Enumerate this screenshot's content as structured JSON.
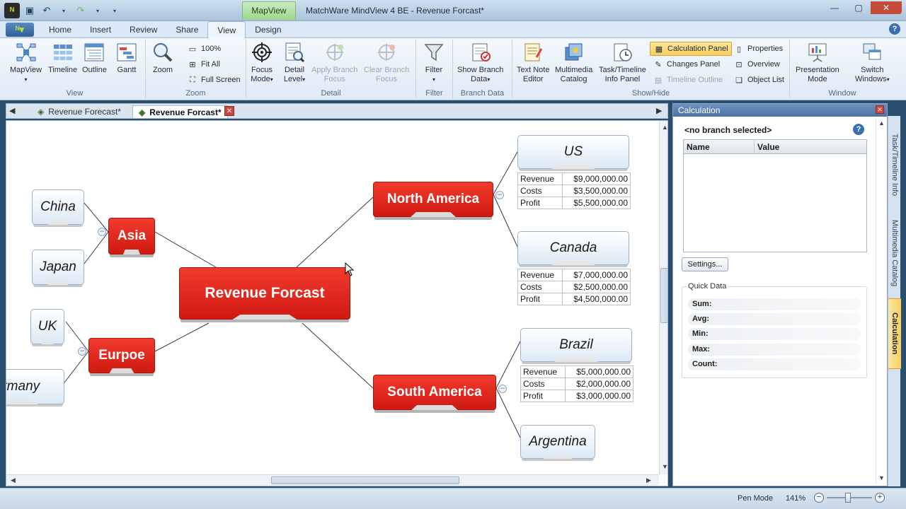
{
  "window": {
    "title": "MatchWare MindView 4 BE - Revenue Forcast*",
    "context_tab": "MapView",
    "controls": [
      "—",
      "▢",
      "✕"
    ]
  },
  "ribbon_tabs": [
    "Home",
    "Insert",
    "Review",
    "Share",
    "View",
    "Design"
  ],
  "active_tab": "View",
  "ribbon": {
    "view": {
      "label": "View",
      "mapview": "MapView",
      "timeline": "Timeline",
      "outline": "Outline",
      "gantt": "Gantt"
    },
    "zoom": {
      "label": "Zoom",
      "zoom": "Zoom",
      "pct100": "100%",
      "fit_all": "Fit All",
      "full_screen": "Full Screen"
    },
    "detail": {
      "label": "Detail",
      "focus_mode_1": "Focus",
      "focus_mode_2": "Mode",
      "detail_level_1": "Detail",
      "detail_level_2": "Level",
      "apply_focus_1": "Apply Branch",
      "apply_focus_2": "Focus",
      "clear_focus_1": "Clear Branch",
      "clear_focus_2": "Focus"
    },
    "filter": {
      "label": "Filter",
      "filter": "Filter"
    },
    "branch_data": {
      "label": "Branch Data",
      "show_1": "Show Branch",
      "show_2": "Data"
    },
    "show_hide": {
      "label": "Show/Hide",
      "text_note_1": "Text Note",
      "text_note_2": "Editor",
      "multimedia_1": "Multimedia",
      "multimedia_2": "Catalog",
      "task_info_1": "Task/Timeline",
      "task_info_2": "Info Panel",
      "calc_panel": "Calculation Panel",
      "changes_panel": "Changes Panel",
      "timeline_outline": "Timeline Outline",
      "properties": "Properties",
      "overview": "Overview",
      "object_list": "Object List"
    },
    "window_group": {
      "label": "Window",
      "presentation_1": "Presentation",
      "presentation_2": "Mode",
      "switch_1": "Switch",
      "switch_2": "Windows"
    }
  },
  "doc_tabs": [
    "Revenue Forecast*",
    "Revenue Forcast*"
  ],
  "map": {
    "root": "Revenue Forcast",
    "branches": {
      "north_america": "North America",
      "south_america": "South America",
      "asia": "Asia",
      "europe": "Eurpoe"
    },
    "subs": {
      "us": "US",
      "canada": "Canada",
      "brazil": "Brazil",
      "argentina": "Argentina",
      "china": "China",
      "japan": "Japan",
      "uk": "UK",
      "germany": "Germany"
    },
    "tables": {
      "us": [
        [
          "Revenue",
          "$9,000,000.00"
        ],
        [
          "Costs",
          "$3,500,000.00"
        ],
        [
          "Profit",
          "$5,500,000.00"
        ]
      ],
      "canada": [
        [
          "Revenue",
          "$7,000,000.00"
        ],
        [
          "Costs",
          "$2,500,000.00"
        ],
        [
          "Profit",
          "$4,500,000.00"
        ]
      ],
      "brazil": [
        [
          "Revenue",
          "$5,000,000.00"
        ],
        [
          "Costs",
          "$2,000,000.00"
        ],
        [
          "Profit",
          "$3,000,000.00"
        ]
      ]
    }
  },
  "calc_panel": {
    "title": "Calculation",
    "selection": "<no branch selected>",
    "col_name": "Name",
    "col_value": "Value",
    "settings": "Settings...",
    "quick_data_title": "Quick Data",
    "quick": [
      "Sum:",
      "Avg:",
      "Min:",
      "Max:",
      "Count:"
    ]
  },
  "side_tabs": [
    "Task/Timeline Info",
    "Multimedia Catalog",
    "Calculation"
  ],
  "status": {
    "pen_mode": "Pen Mode",
    "zoom": "141%"
  }
}
